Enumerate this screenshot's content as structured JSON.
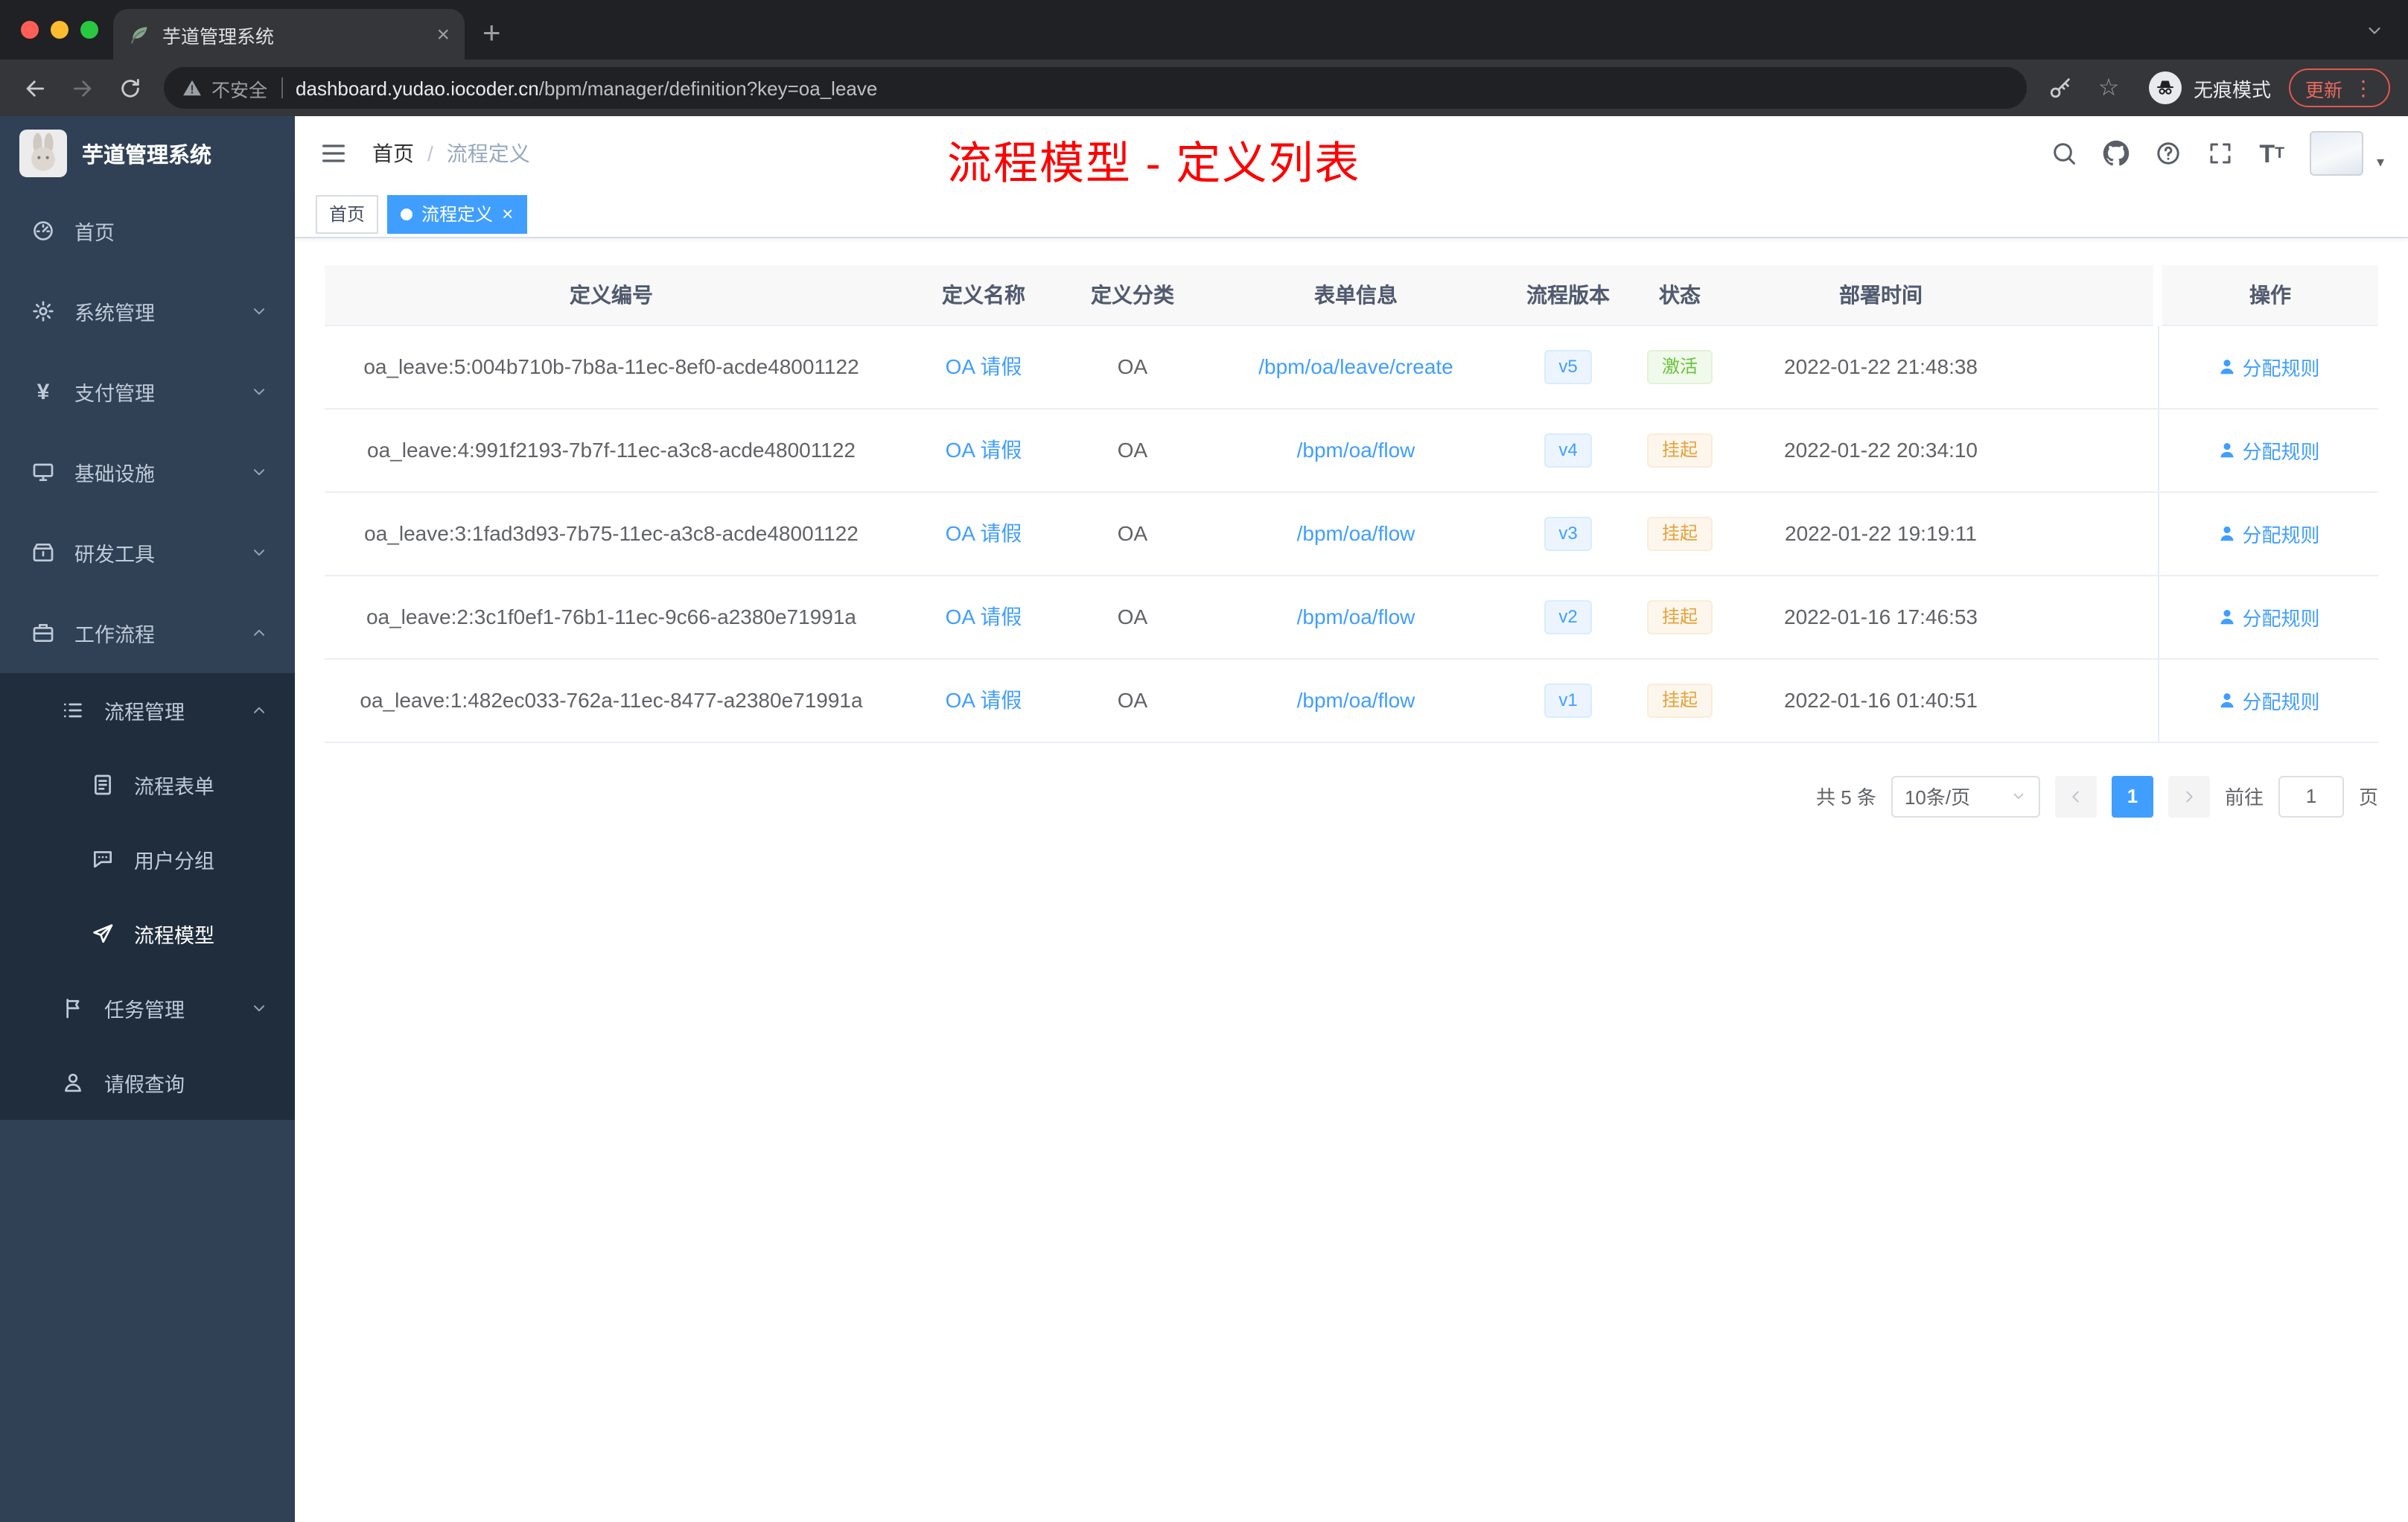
{
  "browser": {
    "traffic_lights": [
      {
        "name": "close",
        "color": "#ff5f57"
      },
      {
        "name": "minimize",
        "color": "#febc2e"
      },
      {
        "name": "zoom",
        "color": "#28c840"
      }
    ],
    "tab_title": "芋道管理系统",
    "security_label": "不安全",
    "url_domain": "dashboard.yudao.iocoder.cn",
    "url_path": "/bpm/manager/definition?key=oa_leave",
    "incognito_label": "无痕模式",
    "update_label": "更新"
  },
  "sidebar": {
    "logo_title": "芋道管理系统",
    "menu": [
      {
        "key": "home",
        "label": "首页",
        "icon": "dashboard-icon",
        "level": 1,
        "chevron": "",
        "submenu": false,
        "active": false
      },
      {
        "key": "system-management",
        "label": "系统管理",
        "icon": "gear-icon",
        "level": 1,
        "chevron": "down",
        "submenu": false,
        "active": false
      },
      {
        "key": "payment-management",
        "label": "支付管理",
        "icon": "yen-icon",
        "level": 1,
        "chevron": "down",
        "submenu": false,
        "active": false
      },
      {
        "key": "infrastructure",
        "label": "基础设施",
        "icon": "monitor-icon",
        "level": 1,
        "chevron": "down",
        "submenu": false,
        "active": false
      },
      {
        "key": "dev-tools",
        "label": "研发工具",
        "icon": "tools-icon",
        "level": 1,
        "chevron": "down",
        "submenu": false,
        "active": false
      },
      {
        "key": "workflow",
        "label": "工作流程",
        "icon": "workflow-icon",
        "level": 1,
        "chevron": "up",
        "submenu": false,
        "active": false
      },
      {
        "key": "process-management",
        "label": "流程管理",
        "icon": "list-icon",
        "level": 2,
        "chevron": "up",
        "submenu": true,
        "active": false
      },
      {
        "key": "process-form",
        "label": "流程表单",
        "icon": "form-icon",
        "level": 3,
        "chevron": "",
        "submenu": true,
        "active": false
      },
      {
        "key": "user-group",
        "label": "用户分组",
        "icon": "users-icon",
        "level": 3,
        "chevron": "",
        "submenu": true,
        "active": false
      },
      {
        "key": "process-model",
        "label": "流程模型",
        "icon": "send-icon",
        "level": 3,
        "chevron": "",
        "submenu": true,
        "active": true
      },
      {
        "key": "task-management",
        "label": "任务管理",
        "icon": "task-icon",
        "level": 2,
        "chevron": "down",
        "submenu": true,
        "active": false
      },
      {
        "key": "leave-query",
        "label": "请假查询",
        "icon": "user-icon",
        "level": 2,
        "chevron": "",
        "submenu": true,
        "active": false
      }
    ]
  },
  "header": {
    "breadcrumb_home": "首页",
    "breadcrumb_current": "流程定义",
    "annotation": "流程模型 - 定义列表"
  },
  "tags": [
    {
      "key": "home",
      "label": "首页",
      "active": false,
      "closable": false
    },
    {
      "key": "process-definition",
      "label": "流程定义",
      "active": true,
      "closable": true
    }
  ],
  "table": {
    "columns": [
      "定义编号",
      "定义名称",
      "定义分类",
      "表单信息",
      "流程版本",
      "状态",
      "部署时间",
      "操作"
    ],
    "rows": [
      {
        "id": "oa_leave:5:004b710b-7b8a-11ec-8ef0-acde48001122",
        "name": "OA 请假",
        "category": "OA",
        "form": "/bpm/oa/leave/create",
        "version": "v5",
        "status": "激活",
        "status_type": "success",
        "deploy_time": "2022-01-22 21:48:38",
        "action": "分配规则"
      },
      {
        "id": "oa_leave:4:991f2193-7b7f-11ec-a3c8-acde48001122",
        "name": "OA 请假",
        "category": "OA",
        "form": "/bpm/oa/flow",
        "version": "v4",
        "status": "挂起",
        "status_type": "warning",
        "deploy_time": "2022-01-22 20:34:10",
        "action": "分配规则"
      },
      {
        "id": "oa_leave:3:1fad3d93-7b75-11ec-a3c8-acde48001122",
        "name": "OA 请假",
        "category": "OA",
        "form": "/bpm/oa/flow",
        "version": "v3",
        "status": "挂起",
        "status_type": "warning",
        "deploy_time": "2022-01-22 19:19:11",
        "action": "分配规则"
      },
      {
        "id": "oa_leave:2:3c1f0ef1-76b1-11ec-9c66-a2380e71991a",
        "name": "OA 请假",
        "category": "OA",
        "form": "/bpm/oa/flow",
        "version": "v2",
        "status": "挂起",
        "status_type": "warning",
        "deploy_time": "2022-01-16 17:46:53",
        "action": "分配规则"
      },
      {
        "id": "oa_leave:1:482ec033-762a-11ec-8477-a2380e71991a",
        "name": "OA 请假",
        "category": "OA",
        "form": "/bpm/oa/flow",
        "version": "v1",
        "status": "挂起",
        "status_type": "warning",
        "deploy_time": "2022-01-16 01:40:51",
        "action": "分配规则"
      }
    ]
  },
  "pagination": {
    "total_label": "共 5 条",
    "page_size_label": "10条/页",
    "current_page": "1",
    "goto_label": "前往",
    "goto_value": "1",
    "page_unit": "页"
  },
  "colors": {
    "primary": "#409eff",
    "success": "#67c23a",
    "warning": "#e6a23c",
    "annotation": "#fe0000",
    "sidebar_bg": "#304156",
    "submenu_bg": "#1f2d3d"
  }
}
